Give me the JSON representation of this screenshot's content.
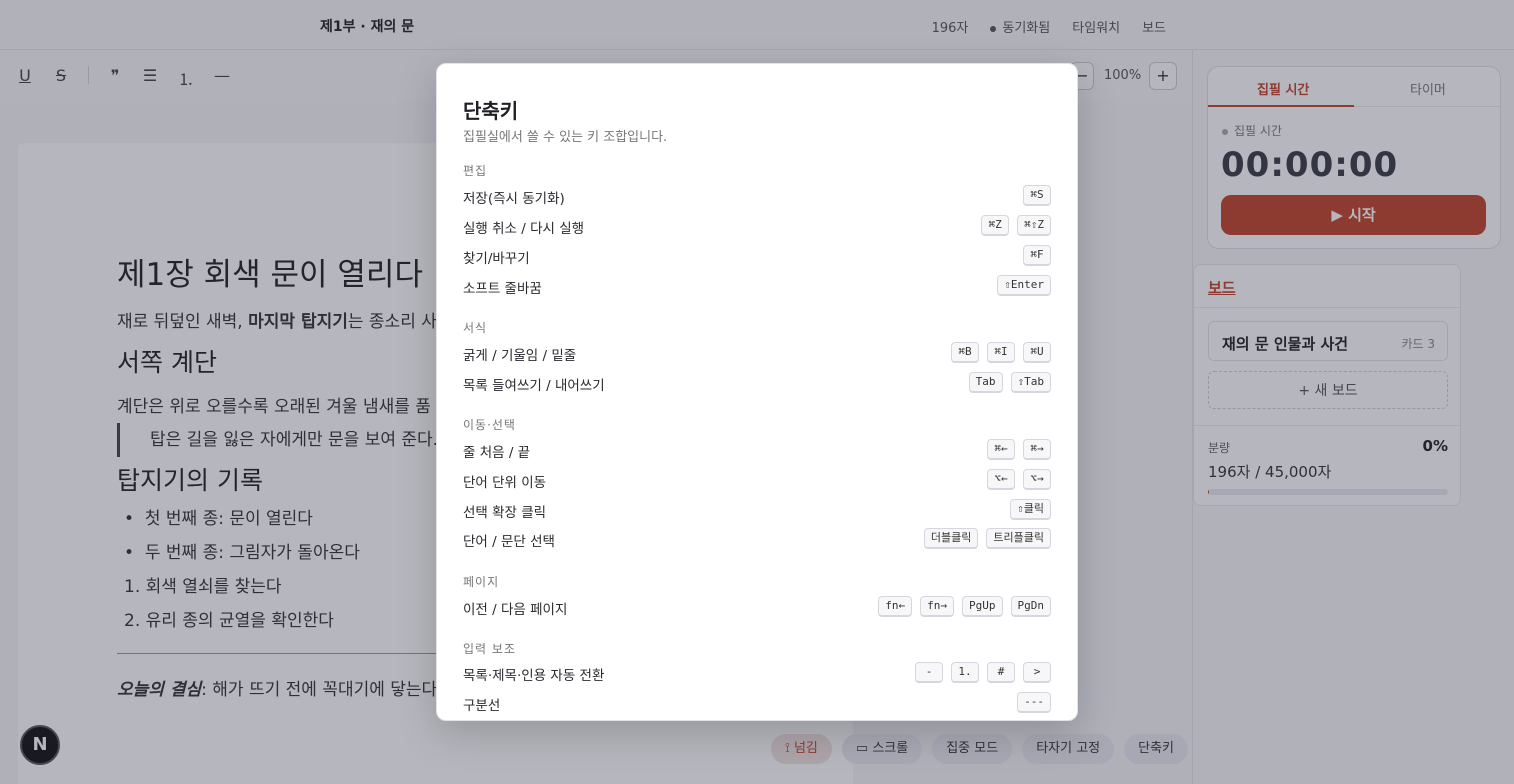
{
  "app": {
    "doc_title": "제1부 · 재의 문",
    "char_count": "196자",
    "sync_status": "동기화됨",
    "typewriter": "타임워치",
    "board_link": "보드"
  },
  "toolbar": {
    "underline": "U",
    "strike": "S",
    "quote": "❞",
    "bullet_list": "☰",
    "ordered_list": "⒈",
    "hr": "—",
    "zoom_out": "−",
    "zoom_level": "100%",
    "zoom_in": "+"
  },
  "doc": {
    "heading": "제1장 회색 문이 열리다",
    "para1_a": "재로 뒤덮인 새벽, ",
    "para1_b": "마지막 탑지기",
    "para1_c": "는 종소리 사",
    "h2_a": "서쪽 계단",
    "para2": "계단은 위로 오를수록 오래된 겨울 냄새를 품",
    "quote": "탑은 길을 잃은 자에게만 문을 보여 준다.",
    "h2_b": "탑지기의 기록",
    "bullet1": "첫 번째 종: 문이 열린다",
    "bullet2": "두 번째 종: 그림자가 돌아온다",
    "ol1": "회색 열쇠를 찾는다",
    "ol2": "유리 종의 균열을 확인한다",
    "resolve_a": "오늘의 결심",
    "resolve_b": ": 해가 뜨기 전에 꼭대기에 닿는다"
  },
  "bottom_bar": {
    "pill_typing": "넘김",
    "pill_scroll": "스크롤",
    "pill_focus": "집중 모드",
    "pill_typewriter": "타자기 고정",
    "pill_shortcuts": "단축키"
  },
  "fab_letter": "N",
  "timer": {
    "tab_focus": "집필 시간",
    "tab_timer": "타이머",
    "label": "집필 시간",
    "value": "00:00:00",
    "start": "▶ 시작"
  },
  "board": {
    "title": "보드",
    "item_name": "재의 문 인물과 사건",
    "item_count": "카드 3",
    "new_board": "+ 새 보드",
    "volume_label": "분량",
    "volume_pct": "0%",
    "volume_value": "196자 / 45,000자",
    "volume_fraction": 0.004
  },
  "modal": {
    "title": "단축키",
    "subtitle": "집필실에서 쓸 수 있는 키 조합입니다.",
    "sections": [
      {
        "title": "편집",
        "rows": [
          {
            "label": "저장(즉시 동기화)",
            "keys": [
              "⌘S"
            ]
          },
          {
            "label": "실행 취소 / 다시 실행",
            "keys": [
              "⌘Z",
              "⌘⇧Z"
            ]
          },
          {
            "label": "찾기/바꾸기",
            "keys": [
              "⌘F"
            ]
          },
          {
            "label": "소프트 줄바꿈",
            "keys": [
              "⇧Enter"
            ]
          }
        ]
      },
      {
        "title": "서식",
        "rows": [
          {
            "label": "굵게 / 기울임 / 밑줄",
            "keys": [
              "⌘B",
              "⌘I",
              "⌘U"
            ]
          },
          {
            "label": "목록 들여쓰기 / 내어쓰기",
            "keys": [
              "Tab",
              "⇧Tab"
            ]
          }
        ]
      },
      {
        "title": "이동·선택",
        "rows": [
          {
            "label": "줄 처음 / 끝",
            "keys": [
              "⌘←",
              "⌘→"
            ]
          },
          {
            "label": "단어 단위 이동",
            "keys": [
              "⌥←",
              "⌥→"
            ]
          },
          {
            "label": "선택 확장 클릭",
            "keys": [
              "⇧클릭"
            ]
          },
          {
            "label": "단어 / 문단 선택",
            "keys": [
              "더블클릭",
              "트리플클릭"
            ]
          }
        ]
      },
      {
        "title": "페이지",
        "rows": [
          {
            "label": "이전 / 다음 페이지",
            "keys": [
              "fn←",
              "fn→",
              "PgUp",
              "PgDn"
            ]
          }
        ]
      },
      {
        "title": "입력 보조",
        "rows": [
          {
            "label": "목록·제목·인용 자동 전환",
            "keys": [
              "-",
              "1.",
              "#",
              ">"
            ]
          },
          {
            "label": "구분선",
            "keys": [
              "---"
            ]
          }
        ]
      }
    ]
  },
  "colors": {
    "accent": "#c1442a",
    "overlay": "rgba(40,44,64,0.34)"
  }
}
